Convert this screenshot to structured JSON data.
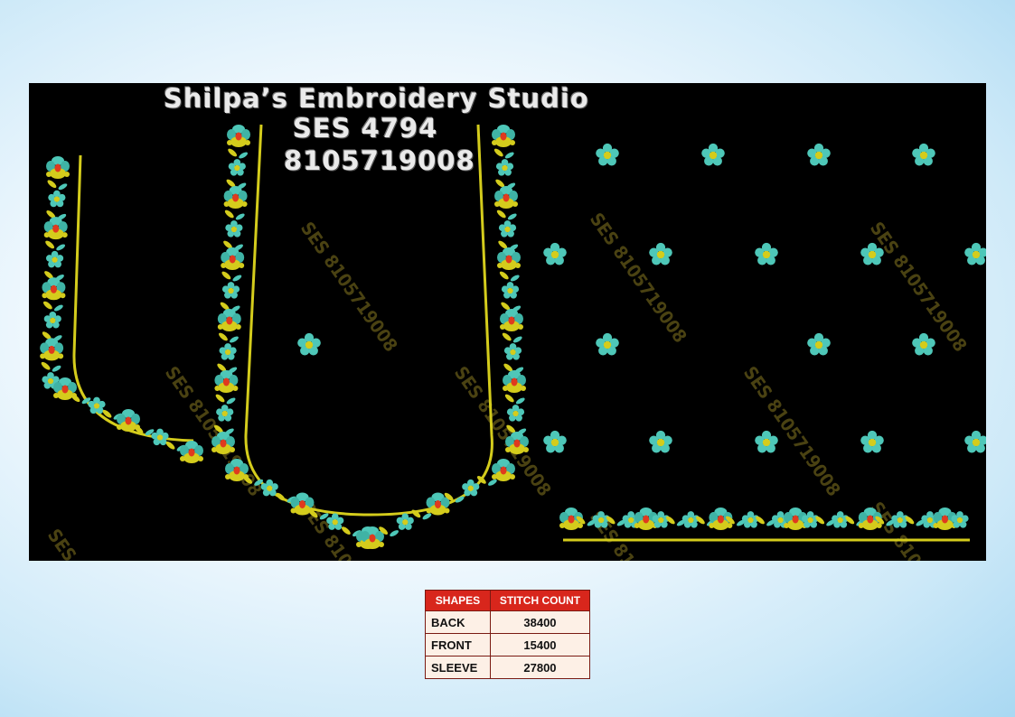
{
  "header": {
    "studio_name": "Shilpa’s Embroidery Studio",
    "design_code": "SES 4794",
    "phone": "8105719008"
  },
  "watermark": "SES 8105719008",
  "colors": {
    "thread_yellow": "#d4cc1c",
    "thread_teal": "#4ec7b8",
    "thread_red": "#e03a1e",
    "table_header": "#d8261c",
    "panel_bg": "#000000"
  },
  "table": {
    "headers": [
      "SHAPES",
      "STITCH COUNT"
    ],
    "rows": [
      {
        "shape": "BACK",
        "count": "38400"
      },
      {
        "shape": "FRONT",
        "count": "15400"
      },
      {
        "shape": "SLEEVE",
        "count": "27800"
      }
    ]
  }
}
